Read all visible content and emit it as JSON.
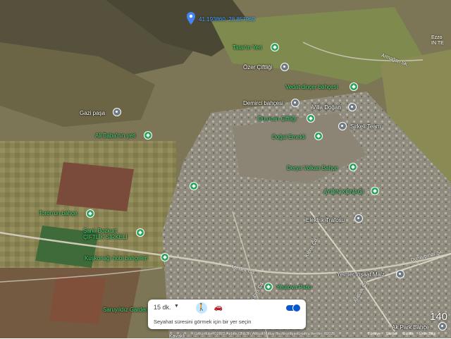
{
  "coordinate_label": "41.193860, 28.857969",
  "top_right_label": [
    "Ezzo",
    "IN TE"
  ],
  "places": [
    {
      "name": "Tatar'ın Yeri",
      "style": "green"
    },
    {
      "name": "Özer Çiftliği",
      "style": "white"
    },
    {
      "name": "Vedat dinçer bahçesi",
      "style": "green"
    },
    {
      "name": "Demirci bahçesi",
      "style": "white"
    },
    {
      "name": "Villa Doğan",
      "style": "white"
    },
    {
      "name": "Durucan Çiftliği",
      "style": "green"
    },
    {
      "name": "Sirkeli Team",
      "style": "white"
    },
    {
      "name": "Gazi paşa",
      "style": "white"
    },
    {
      "name": "Ali Baba'nın yeri",
      "style": "green"
    },
    {
      "name": "Doğal Emekli",
      "style": "green"
    },
    {
      "name": "Derya Volkan Bahçe",
      "style": "green"
    },
    {
      "name": "AYDIN KONAĞI",
      "style": "green"
    },
    {
      "name": "Toron'un bahçe",
      "style": "green"
    },
    {
      "name": "Elektrik Trafosu",
      "style": "white"
    },
    {
      "name": "Şanlı Bozkurt ÇİFTLİK SİRKELİ",
      "style": "green"
    },
    {
      "name": "Kuşkonağı hobi bahçeleri",
      "style": "green"
    },
    {
      "name": "Yeşilova Parkı",
      "style": "green"
    },
    {
      "name": "Yelmer İnşaat Malz",
      "style": "white"
    },
    {
      "name": "Ak Park Bahçe",
      "style": "white"
    },
    {
      "name": "Saruyıldız Garden",
      "style": "green"
    }
  ],
  "roads": [
    "Armağan Sk.",
    "Kıbrıs Cd.",
    "Meslek Cd.",
    "Kıbrıs Cd.",
    "Atatürk Cd.",
    "Dumlupınar Sk.",
    "Kavaklı"
  ],
  "panel": {
    "duration": "15 dk.",
    "hint": "Seyahat süresini görmek için bir yer seçin"
  },
  "attribution": "Görüntüler ©2025 Airbus,CNES / Airbus,Maxar Technologies,Harita verileri ©2025",
  "footer_links": [
    "Türkiye",
    "Şartlar",
    "Gizlilik",
    "Ürün Bilgi"
  ],
  "scale_number": "140",
  "colors": {
    "accent": "#0b57d0",
    "green_label": "#44e07a",
    "pin_grey": "#707a84",
    "pin_green": "#2aa35a"
  }
}
